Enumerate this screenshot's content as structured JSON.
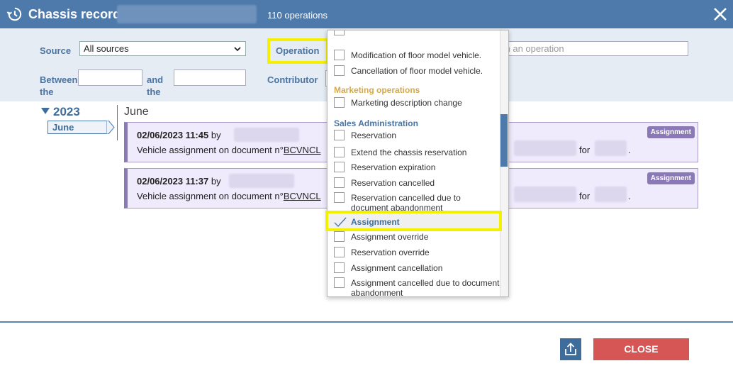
{
  "header": {
    "title": "Chassis record",
    "operations_count": "110 operations"
  },
  "filters": {
    "source_label": "Source",
    "source_value": "All sources",
    "operation_label": "Operation",
    "between_label_1": "Between",
    "between_label_2": "the",
    "and_label_1": "and",
    "and_label_2": "the",
    "contributor_label": "Contributor",
    "search_placeholder": "Search an operation",
    "search_visible": "ch an operation"
  },
  "timeline": {
    "year": "2023",
    "month_tab": "June",
    "month_heading": "June"
  },
  "cards": [
    {
      "datetime": "02/06/2023 11:45",
      "by": "by",
      "desc_prefix": "Vehicle assignment on document n°",
      "doc_ref": "BCVNCL",
      "for": "for",
      "dot": ".",
      "badge": "Assignment"
    },
    {
      "datetime": "02/06/2023 11:37",
      "by": "by",
      "desc_prefix": "Vehicle assignment on document n°",
      "doc_ref": "BCVNCL",
      "for": "for",
      "dot": ".",
      "badge": "Assignment"
    }
  ],
  "operation_dropdown": {
    "items_top": [
      "Modification of floor model vehicle.",
      "Cancellation of floor model vehicle."
    ],
    "group_marketing": "Marketing operations",
    "items_marketing": [
      "Marketing description change"
    ],
    "group_sales": "Sales Administration",
    "items_sales": [
      "Reservation",
      "Extend the chassis reservation",
      "Reservation expiration",
      "Reservation cancelled",
      "Reservation cancelled due to document abandonment",
      "Assignment",
      "Assignment override",
      "Reservation override",
      "Assignment cancellation",
      "Assignment cancelled due to document abandonment"
    ],
    "selected": "Assignment"
  },
  "footer": {
    "close_label": "CLOSE"
  },
  "colors": {
    "header_bg": "#4d7aab",
    "filter_bg": "#e5ecf4",
    "label_color": "#4b74a1",
    "card_bg": "#efeafc",
    "card_accent": "#8b79b7",
    "marketing_group": "#d4a94a",
    "sales_group": "#4b74a1",
    "close_button": "#d65555",
    "highlight": "#f5f000"
  },
  "icons": {
    "header": "history-icon",
    "close": "close-icon",
    "export": "export-icon",
    "selected_mark": "check-icon"
  }
}
